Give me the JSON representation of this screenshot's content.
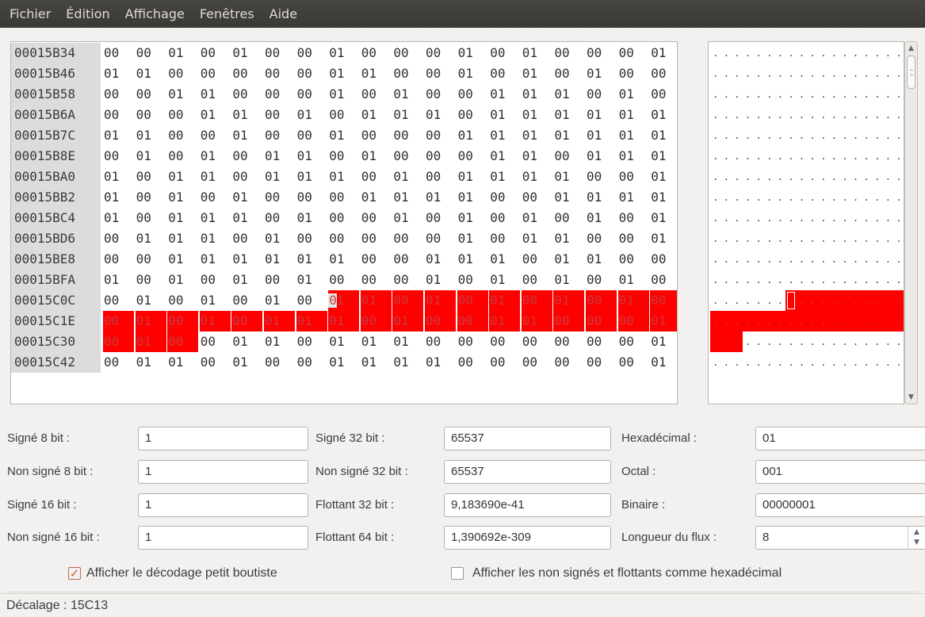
{
  "menu": [
    "Fichier",
    "Édition",
    "Affichage",
    "Fenêtres",
    "Aide"
  ],
  "hex": {
    "rows": [
      {
        "address": "00015B34",
        "bytes": [
          "00",
          "00",
          "01",
          "00",
          "01",
          "00",
          "00",
          "01",
          "00",
          "00",
          "00",
          "01",
          "00",
          "01",
          "00",
          "00",
          "00",
          "01"
        ]
      },
      {
        "address": "00015B46",
        "bytes": [
          "01",
          "01",
          "00",
          "00",
          "00",
          "00",
          "00",
          "01",
          "01",
          "00",
          "00",
          "01",
          "00",
          "01",
          "00",
          "01",
          "00",
          "00"
        ]
      },
      {
        "address": "00015B58",
        "bytes": [
          "00",
          "00",
          "01",
          "01",
          "00",
          "00",
          "00",
          "01",
          "00",
          "01",
          "00",
          "00",
          "01",
          "01",
          "01",
          "00",
          "01",
          "00"
        ]
      },
      {
        "address": "00015B6A",
        "bytes": [
          "00",
          "00",
          "00",
          "01",
          "01",
          "00",
          "01",
          "00",
          "01",
          "01",
          "01",
          "00",
          "01",
          "01",
          "01",
          "01",
          "01",
          "01"
        ]
      },
      {
        "address": "00015B7C",
        "bytes": [
          "01",
          "01",
          "00",
          "00",
          "01",
          "00",
          "00",
          "01",
          "00",
          "00",
          "00",
          "01",
          "01",
          "01",
          "01",
          "01",
          "01",
          "01"
        ]
      },
      {
        "address": "00015B8E",
        "bytes": [
          "00",
          "01",
          "00",
          "01",
          "00",
          "01",
          "01",
          "00",
          "01",
          "00",
          "00",
          "00",
          "01",
          "01",
          "00",
          "01",
          "01",
          "01"
        ]
      },
      {
        "address": "00015BA0",
        "bytes": [
          "01",
          "00",
          "01",
          "01",
          "00",
          "01",
          "01",
          "01",
          "00",
          "01",
          "00",
          "01",
          "01",
          "01",
          "01",
          "00",
          "00",
          "01"
        ]
      },
      {
        "address": "00015BB2",
        "bytes": [
          "01",
          "00",
          "01",
          "00",
          "01",
          "00",
          "00",
          "00",
          "01",
          "01",
          "01",
          "01",
          "00",
          "00",
          "01",
          "01",
          "01",
          "01"
        ]
      },
      {
        "address": "00015BC4",
        "bytes": [
          "01",
          "00",
          "01",
          "01",
          "01",
          "00",
          "01",
          "00",
          "00",
          "01",
          "00",
          "01",
          "00",
          "01",
          "00",
          "01",
          "00",
          "01"
        ]
      },
      {
        "address": "00015BD6",
        "bytes": [
          "00",
          "01",
          "01",
          "01",
          "00",
          "01",
          "00",
          "00",
          "00",
          "00",
          "00",
          "01",
          "00",
          "01",
          "01",
          "00",
          "00",
          "01"
        ]
      },
      {
        "address": "00015BE8",
        "bytes": [
          "00",
          "00",
          "01",
          "01",
          "01",
          "01",
          "01",
          "01",
          "00",
          "00",
          "01",
          "01",
          "01",
          "00",
          "01",
          "01",
          "00",
          "00"
        ]
      },
      {
        "address": "00015BFA",
        "bytes": [
          "01",
          "00",
          "01",
          "00",
          "01",
          "00",
          "01",
          "00",
          "00",
          "00",
          "01",
          "00",
          "01",
          "00",
          "01",
          "00",
          "01",
          "00"
        ]
      },
      {
        "address": "00015C0C",
        "bytes": [
          "00",
          "01",
          "00",
          "01",
          "00",
          "01",
          "00",
          "01",
          "01",
          "00",
          "01",
          "00",
          "01",
          "00",
          "01",
          "00",
          "01",
          "00"
        ]
      },
      {
        "address": "00015C1E",
        "bytes": [
          "00",
          "01",
          "00",
          "01",
          "00",
          "01",
          "01",
          "01",
          "00",
          "01",
          "00",
          "00",
          "01",
          "01",
          "00",
          "00",
          "00",
          "01"
        ]
      },
      {
        "address": "00015C30",
        "bytes": [
          "00",
          "01",
          "00",
          "00",
          "01",
          "01",
          "00",
          "01",
          "01",
          "01",
          "00",
          "00",
          "00",
          "00",
          "00",
          "00",
          "00",
          "01"
        ]
      },
      {
        "address": "00015C42",
        "bytes": [
          "00",
          "01",
          "01",
          "00",
          "01",
          "00",
          "00",
          "01",
          "01",
          "01",
          "01",
          "00",
          "00",
          "00",
          "00",
          "00",
          "00",
          "01"
        ]
      }
    ],
    "ascii_char": ".",
    "selection_start": {
      "row": 12,
      "col": 7
    },
    "selection_end": {
      "row": 14,
      "col": 2
    },
    "cursor": {
      "row": 12,
      "col": 7
    }
  },
  "form": {
    "signed8": {
      "label": "Signé 8 bit :",
      "value": "1"
    },
    "unsigned8": {
      "label": "Non signé 8 bit :",
      "value": "1"
    },
    "signed16": {
      "label": "Signé 16 bit :",
      "value": "1"
    },
    "unsigned16": {
      "label": "Non signé 16 bit :",
      "value": "1"
    },
    "signed32": {
      "label": "Signé 32 bit :",
      "value": "65537"
    },
    "unsigned32": {
      "label": "Non signé 32 bit :",
      "value": "65537"
    },
    "float32": {
      "label": "Flottant 32 bit :",
      "value": "9,183690e-41"
    },
    "float64": {
      "label": "Flottant 64 bit :",
      "value": "1,390692e-309"
    },
    "hex": {
      "label": "Hexadécimal :",
      "value": "01"
    },
    "octal": {
      "label": "Octal :",
      "value": "001"
    },
    "binary": {
      "label": "Binaire :",
      "value": "00000001"
    },
    "stream_length": {
      "label": "Longueur du flux :",
      "value": "8"
    }
  },
  "options": {
    "little_endian": {
      "label": "Afficher le décodage petit boutiste",
      "checked": true
    },
    "unsigned_hex": {
      "label": "Afficher les non signés et flottants comme hexadécimal",
      "checked": false
    }
  },
  "status": {
    "text": "Décalage : 15C13"
  },
  "colors": {
    "selection": "#ff0000",
    "menubar": "#3c3b37"
  }
}
